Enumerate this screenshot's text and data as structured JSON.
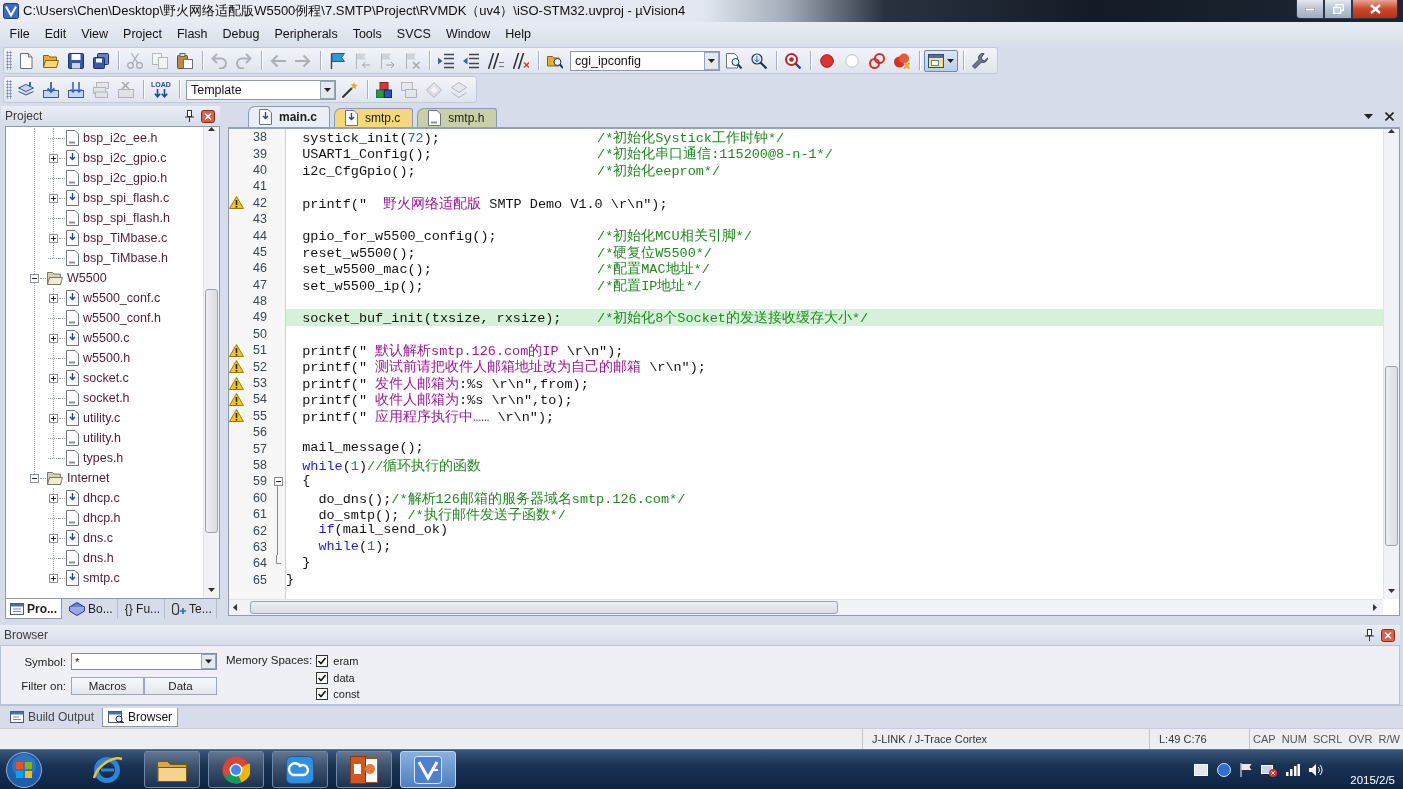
{
  "window": {
    "title": "C:\\Users\\Chen\\Desktop\\野火网络适配版W5500例程\\7.SMTP\\Project\\RVMDK（uv4）\\iSO-STM32.uvproj - µVision4"
  },
  "menu": [
    "File",
    "Edit",
    "View",
    "Project",
    "Flash",
    "Debug",
    "Peripherals",
    "Tools",
    "SVCS",
    "Window",
    "Help"
  ],
  "toolbars": [
    [
      {
        "kind": "new",
        "disabled": false
      },
      {
        "kind": "open",
        "disabled": false
      },
      {
        "kind": "save",
        "disabled": false
      },
      {
        "kind": "save_all",
        "disabled": false
      },
      {
        "kind": "separator"
      },
      {
        "kind": "cut",
        "disabled": true
      },
      {
        "kind": "copy",
        "disabled": true
      },
      {
        "kind": "paste",
        "disabled": false
      },
      {
        "kind": "separator"
      },
      {
        "kind": "undo",
        "disabled": true
      },
      {
        "kind": "redo",
        "disabled": true
      },
      {
        "kind": "separator"
      },
      {
        "kind": "back",
        "disabled": true
      },
      {
        "kind": "forward",
        "disabled": true
      },
      {
        "kind": "separator"
      },
      {
        "kind": "bookmark",
        "disabled": false
      },
      {
        "kind": "prev_bookmark",
        "disabled": true
      },
      {
        "kind": "next_bookmark",
        "disabled": true
      },
      {
        "kind": "clear_bookmarks",
        "disabled": true
      },
      {
        "kind": "separator"
      },
      {
        "kind": "indent",
        "disabled": false
      },
      {
        "kind": "unindent",
        "disabled": false
      },
      {
        "kind": "comment",
        "disabled": false
      },
      {
        "kind": "uncomment",
        "disabled": false
      },
      {
        "kind": "separator"
      },
      {
        "kind": "find_in_files",
        "disabled": false
      },
      {
        "kind": "combo",
        "value": "cgi_ipconfig"
      },
      {
        "kind": "find",
        "disabled": false
      },
      {
        "kind": "incremental_find",
        "disabled": false
      },
      {
        "kind": "separator"
      },
      {
        "kind": "debug",
        "disabled": false
      },
      {
        "kind": "separator"
      },
      {
        "kind": "breakpoint",
        "disabled": false
      },
      {
        "kind": "enable_breakpoint",
        "disabled": false
      },
      {
        "kind": "disable_breakpoints",
        "disabled": false
      },
      {
        "kind": "kill_breakpoints",
        "disabled": false
      },
      {
        "kind": "separator"
      },
      {
        "kind": "window_dropdown",
        "disabled": false
      },
      {
        "kind": "separator"
      },
      {
        "kind": "configure",
        "disabled": false
      }
    ],
    [
      {
        "kind": "translate",
        "disabled": false
      },
      {
        "kind": "build",
        "disabled": false
      },
      {
        "kind": "rebuild",
        "disabled": false
      },
      {
        "kind": "batch_build",
        "disabled": true
      },
      {
        "kind": "stop_build",
        "disabled": true
      },
      {
        "kind": "separator"
      },
      {
        "kind": "download",
        "label": "LOAD",
        "disabled": false
      },
      {
        "kind": "separator"
      },
      {
        "kind": "combo",
        "value": "Template"
      },
      {
        "kind": "target_options",
        "disabled": false
      },
      {
        "kind": "separator"
      },
      {
        "kind": "manage_components",
        "disabled": false
      },
      {
        "kind": "stacked_windows",
        "disabled": true
      },
      {
        "kind": "diamond",
        "disabled": true
      },
      {
        "kind": "overlap_frames",
        "disabled": true
      }
    ]
  ],
  "project_panel": {
    "title": "Project",
    "tree": {
      "continued": [
        {
          "label": "bsp_i2c_ee.h",
          "kind": "header"
        },
        {
          "label": "bsp_i2c_gpio.c",
          "kind": "source",
          "expanded": false
        },
        {
          "label": "bsp_i2c_gpio.h",
          "kind": "header"
        },
        {
          "label": "bsp_spi_flash.c",
          "kind": "source",
          "expanded": false
        },
        {
          "label": "bsp_spi_flash.h",
          "kind": "header"
        },
        {
          "label": "bsp_TiMbase.c",
          "kind": "source",
          "expanded": false
        },
        {
          "label": "bsp_TiMbase.h",
          "kind": "header"
        }
      ],
      "groups": [
        {
          "label": "W5500",
          "kind": "folder",
          "expanded": true,
          "children": [
            {
              "label": "w5500_conf.c",
              "kind": "source",
              "expanded": false
            },
            {
              "label": "w5500_conf.h",
              "kind": "header"
            },
            {
              "label": "w5500.c",
              "kind": "source",
              "expanded": false
            },
            {
              "label": "w5500.h",
              "kind": "header"
            },
            {
              "label": "socket.c",
              "kind": "source",
              "expanded": false
            },
            {
              "label": "socket.h",
              "kind": "header"
            },
            {
              "label": "utility.c",
              "kind": "source",
              "expanded": false
            },
            {
              "label": "utility.h",
              "kind": "header"
            },
            {
              "label": "types.h",
              "kind": "header"
            }
          ]
        },
        {
          "label": "Internet",
          "kind": "folder",
          "expanded": true,
          "children": [
            {
              "label": "dhcp.c",
              "kind": "source",
              "expanded": false
            },
            {
              "label": "dhcp.h",
              "kind": "header"
            },
            {
              "label": "dns.c",
              "kind": "source",
              "expanded": false
            },
            {
              "label": "dns.h",
              "kind": "header"
            },
            {
              "label": "smtp.c",
              "kind": "source",
              "expanded": false
            }
          ]
        }
      ]
    },
    "tabs": [
      {
        "label": "Pro...",
        "kind": "project",
        "selected": true
      },
      {
        "label": "Bo...",
        "kind": "books",
        "selected": false
      },
      {
        "label": "Fu...",
        "kind": "functions",
        "glyph": "{}",
        "selected": false
      },
      {
        "label": "Te...",
        "kind": "templates",
        "selected": false
      }
    ]
  },
  "editor": {
    "tabs": [
      {
        "label": "main.c",
        "kind": "source",
        "selected": true,
        "color": "#e9eef7"
      },
      {
        "label": "smtp.c",
        "kind": "source",
        "selected": false,
        "color": "#f5d77c"
      },
      {
        "label": "smtp.h",
        "kind": "header",
        "selected": false,
        "color": "#c9cfa6"
      }
    ],
    "lines": [
      {
        "number": "38",
        "warning": false,
        "current": false,
        "code": [
          {
            "kind": "plain",
            "text": "  systick_init("
          },
          {
            "kind": "number",
            "text": "72"
          },
          {
            "kind": "plain",
            "text": ");"
          }
        ],
        "comment": "/*初始化Systick工作时钟*/"
      },
      {
        "number": "39",
        "warning": false,
        "current": false,
        "code": [
          {
            "kind": "plain",
            "text": "  USART1_Config();"
          }
        ],
        "comment": "/*初始化串口通信:115200@8-n-1*/"
      },
      {
        "number": "40",
        "warning": false,
        "current": false,
        "code": [
          {
            "kind": "plain",
            "text": "  i2c_CfgGpio();"
          }
        ],
        "comment": "/*初始化eeprom*/"
      },
      {
        "number": "41",
        "warning": false,
        "current": false
      },
      {
        "number": "42",
        "warning": true,
        "current": false,
        "code": [
          {
            "kind": "plain",
            "text": "  printf(\"  "
          },
          {
            "kind": "string",
            "text": "野火网络适配版"
          },
          {
            "kind": "plain",
            "text": " SMTP Demo V1.0 \\r\\n\");"
          }
        ]
      },
      {
        "number": "43",
        "warning": false,
        "current": false
      },
      {
        "number": "44",
        "warning": false,
        "current": false,
        "code": [
          {
            "kind": "plain",
            "text": "  gpio_for_w5500_config();"
          }
        ],
        "comment": "/*初始化MCU相关引脚*/"
      },
      {
        "number": "45",
        "warning": false,
        "current": false,
        "code": [
          {
            "kind": "plain",
            "text": "  reset_w5500();"
          }
        ],
        "comment": "/*硬复位W5500*/"
      },
      {
        "number": "46",
        "warning": false,
        "current": false,
        "code": [
          {
            "kind": "plain",
            "text": "  set_w5500_mac();"
          }
        ],
        "comment": "/*配置MAC地址*/"
      },
      {
        "number": "47",
        "warning": false,
        "current": false,
        "code": [
          {
            "kind": "plain",
            "text": "  set_w5500_ip();"
          }
        ],
        "comment": "/*配置IP地址*/"
      },
      {
        "number": "48",
        "warning": false,
        "current": false
      },
      {
        "number": "49",
        "warning": false,
        "current": true,
        "code": [
          {
            "kind": "plain",
            "text": "  socket_buf_init(txsize, rxsize);"
          }
        ],
        "comment": "/*初始化8个Socket的发送接收缓存大小*/"
      },
      {
        "number": "50",
        "warning": false,
        "current": false
      },
      {
        "number": "51",
        "warning": true,
        "current": false,
        "code": [
          {
            "kind": "plain",
            "text": "  printf(\" "
          },
          {
            "kind": "string",
            "text": "默认解析smtp.126.com的IP"
          },
          {
            "kind": "plain",
            "text": " \\r\\n\");"
          }
        ]
      },
      {
        "number": "52",
        "warning": true,
        "current": false,
        "code": [
          {
            "kind": "plain",
            "text": "  printf(\" "
          },
          {
            "kind": "string",
            "text": "测试前请把收件人邮箱地址改为自己的邮箱"
          },
          {
            "kind": "plain",
            "text": " \\r\\n\");"
          }
        ]
      },
      {
        "number": "53",
        "warning": true,
        "current": false,
        "code": [
          {
            "kind": "plain",
            "text": "  printf(\" "
          },
          {
            "kind": "string",
            "text": "发件人邮箱为"
          },
          {
            "kind": "plain",
            "text": ":%s \\r\\n\",from);"
          }
        ]
      },
      {
        "number": "54",
        "warning": true,
        "current": false,
        "code": [
          {
            "kind": "plain",
            "text": "  printf(\" "
          },
          {
            "kind": "string",
            "text": "收件人邮箱为"
          },
          {
            "kind": "plain",
            "text": ":%s \\r\\n\",to);"
          }
        ]
      },
      {
        "number": "55",
        "warning": true,
        "current": false,
        "code": [
          {
            "kind": "plain",
            "text": "  printf(\" "
          },
          {
            "kind": "string",
            "text": "应用程序执行中……"
          },
          {
            "kind": "plain",
            "text": " \\r\\n\");"
          }
        ]
      },
      {
        "number": "56",
        "warning": false,
        "current": false
      },
      {
        "number": "57",
        "warning": false,
        "current": false,
        "code": [
          {
            "kind": "plain",
            "text": "  mail_message();"
          }
        ]
      },
      {
        "number": "58",
        "warning": false,
        "current": false,
        "code": [
          {
            "kind": "keyword",
            "text": "  while"
          },
          {
            "kind": "plain",
            "text": "("
          },
          {
            "kind": "number",
            "text": "1"
          },
          {
            "kind": "plain",
            "text": ")"
          },
          {
            "kind": "comment",
            "text": "//循环执行的函数"
          }
        ]
      },
      {
        "number": "59",
        "warning": false,
        "current": false,
        "fold_open": true,
        "code": [
          {
            "kind": "plain",
            "text": "  {"
          }
        ]
      },
      {
        "number": "60",
        "warning": false,
        "current": false,
        "code": [
          {
            "kind": "plain",
            "text": "    do_dns();"
          },
          {
            "kind": "comment",
            "text": "/*解析126邮箱的服务器域名smtp.126.com*/"
          }
        ]
      },
      {
        "number": "61",
        "warning": false,
        "current": false,
        "code": [
          {
            "kind": "plain",
            "text": "    do_smtp(); "
          },
          {
            "kind": "comment",
            "text": "/*执行邮件发送子函数*/"
          }
        ]
      },
      {
        "number": "62",
        "warning": false,
        "current": false,
        "code": [
          {
            "kind": "keyword",
            "text": "    if"
          },
          {
            "kind": "plain",
            "text": "(mail_send_ok)"
          }
        ]
      },
      {
        "number": "63",
        "warning": false,
        "current": false,
        "code": [
          {
            "kind": "keyword",
            "text": "    while"
          },
          {
            "kind": "plain",
            "text": "("
          },
          {
            "kind": "number",
            "text": "1"
          },
          {
            "kind": "plain",
            "text": ");"
          }
        ]
      },
      {
        "number": "64",
        "warning": false,
        "current": false,
        "fold_end": true,
        "code": [
          {
            "kind": "plain",
            "text": "  }"
          }
        ]
      },
      {
        "number": "65",
        "warning": false,
        "current": false,
        "code": [
          {
            "kind": "plain",
            "text": "}"
          }
        ]
      }
    ]
  },
  "browser": {
    "title": "Browser",
    "symbol_label": "Symbol:",
    "symbol_value": "*",
    "filter_label": "Filter on:",
    "filters": [
      "Macros",
      "Data"
    ],
    "memory_label": "Memory Spaces:",
    "memory_spaces": [
      {
        "label": "eram",
        "checked": true
      },
      {
        "label": "data",
        "checked": true
      },
      {
        "label": "const",
        "checked": true
      }
    ]
  },
  "output_tabs": [
    {
      "label": "Build Output",
      "kind": "build",
      "selected": false
    },
    {
      "label": "Browser",
      "kind": "browser",
      "selected": true
    }
  ],
  "status_bar": {
    "target": "J-LINK / J-Trace Cortex",
    "position": "L:49 C:76",
    "indicators": [
      "CAP",
      "NUM",
      "SCRL",
      "OVR",
      "R/W"
    ]
  },
  "taskbar": {
    "apps": [
      {
        "kind": "browser_e",
        "running": false,
        "selected": false
      },
      {
        "kind": "folder",
        "running": true,
        "selected": false
      },
      {
        "kind": "browser_ring",
        "running": true,
        "selected": false
      },
      {
        "kind": "cloud",
        "running": true,
        "selected": false
      },
      {
        "kind": "slides",
        "running": true,
        "selected": false
      },
      {
        "kind": "ide",
        "running": true,
        "selected": true
      }
    ],
    "date": "2015/2/5"
  }
}
